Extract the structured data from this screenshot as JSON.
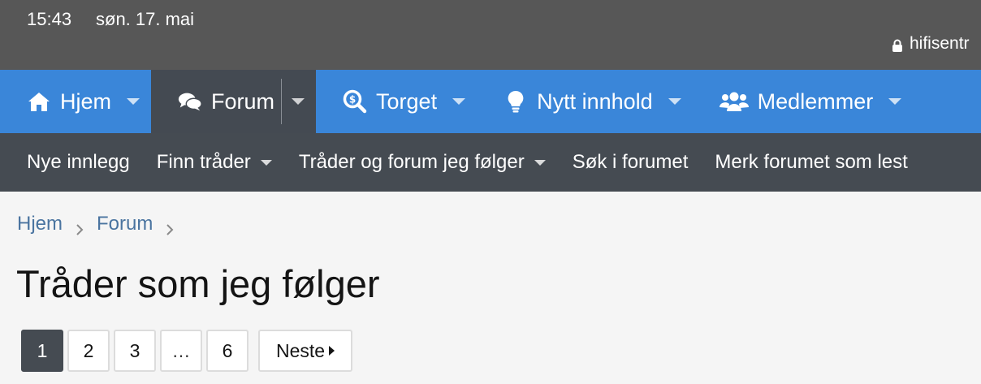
{
  "status": {
    "time": "15:43",
    "date": "søn. 17. mai",
    "url": "hifisentr"
  },
  "mainnav": {
    "tabs": [
      {
        "label": "Hjem",
        "icon": "home-icon"
      },
      {
        "label": "Forum",
        "icon": "comments-icon",
        "selected": true
      },
      {
        "label": "Torget",
        "icon": "search-dollar-icon"
      },
      {
        "label": "Nytt innhold",
        "icon": "lightbulb-icon"
      },
      {
        "label": "Medlemmer",
        "icon": "users-icon"
      }
    ]
  },
  "subnav": {
    "items": [
      {
        "label": "Nye innlegg"
      },
      {
        "label": "Finn tråder",
        "dropdown": true
      },
      {
        "label": "Tråder og forum jeg følger",
        "dropdown": true
      },
      {
        "label": "Søk i forumet"
      },
      {
        "label": "Merk forumet som lest"
      }
    ]
  },
  "breadcrumb": [
    "Hjem",
    "Forum"
  ],
  "page_title": "Tråder som jeg følger",
  "pagination": {
    "pages": [
      "1",
      "2",
      "3",
      "…",
      "6"
    ],
    "current": "1",
    "next_label": "Neste"
  },
  "colors": {
    "status_bar": "#575757",
    "main_nav": "#3a86d9",
    "selected_tab": "#444a52",
    "sub_nav": "#454b52",
    "link": "#4a74a0"
  }
}
